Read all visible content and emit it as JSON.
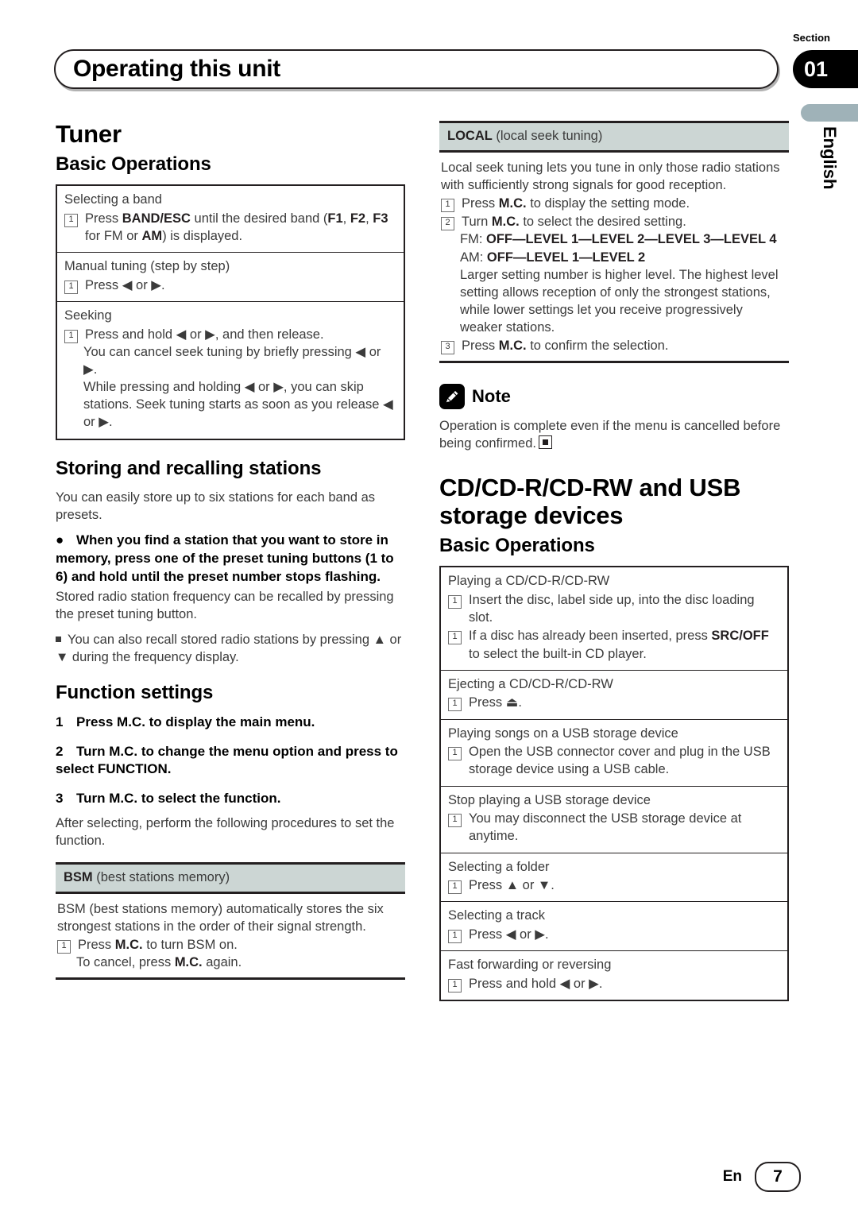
{
  "header": {
    "title": "Operating this unit",
    "section_label": "Section",
    "section_number": "01",
    "language_tab": "English"
  },
  "footer": {
    "language_code": "En",
    "page_number": "7"
  },
  "left_column": {
    "heading": "Tuner",
    "basic_operations_heading": "Basic Operations",
    "basic_operations": [
      {
        "title": "Selecting a band",
        "steps": [
          {
            "num": "1",
            "html": "Press <b>BAND/ESC</b> until the desired band (<b>F1</b>, <b>F2</b>, <b>F3</b> for FM or <b>AM</b>) is displayed."
          }
        ],
        "notes": []
      },
      {
        "title": "Manual tuning (step by step)",
        "steps": [
          {
            "num": "1",
            "html": "Press ◀ or ▶."
          }
        ],
        "notes": []
      },
      {
        "title": "Seeking",
        "steps": [
          {
            "num": "1",
            "html": "Press and hold ◀ or ▶, and then release."
          }
        ],
        "notes": [
          "You can cancel seek tuning by briefly pressing ◀ or ▶.",
          "While pressing and holding ◀ or ▶, you can skip stations. Seek tuning starts as soon as you release ◀ or ▶."
        ]
      }
    ],
    "storing_heading": "Storing and recalling stations",
    "storing_intro": "You can easily store up to six stations for each band as presets.",
    "storing_bold": "When you find a station that you want to store in memory, press one of the preset tuning buttons (1 to 6) and hold until the preset number stops flashing.",
    "storing_after": "Stored radio station frequency can be recalled by pressing the preset tuning button.",
    "storing_note": "You can also recall stored radio stations by pressing ▲ or ▼ during the frequency display.",
    "function_heading": "Function settings",
    "function_steps": [
      {
        "n": "1",
        "text": "Press M.C. to display the main menu."
      },
      {
        "n": "2",
        "text": "Turn M.C. to change the menu option and press to select FUNCTION."
      },
      {
        "n": "3",
        "text": "Turn M.C. to select the function."
      }
    ],
    "function_after": "After selecting, perform the following procedures to set the function.",
    "bsm": {
      "head_bold": "BSM",
      "head_rest": "(best stations memory)",
      "intro": "BSM (best stations memory) automatically stores the six strongest stations in the order of their signal strength.",
      "steps": [
        {
          "num": "1",
          "html": "Press <b>M.C.</b> to turn BSM on."
        }
      ],
      "sub_lines": [
        "To cancel, press <b>M.C.</b> again."
      ]
    }
  },
  "right_column": {
    "local": {
      "head_bold": "LOCAL",
      "head_rest": "(local seek tuning)",
      "intro": "Local seek tuning lets you tune in only those radio stations with sufficiently strong signals for good reception.",
      "steps": [
        {
          "num": "1",
          "html": "Press <b>M.C.</b> to display the setting mode."
        },
        {
          "num": "2",
          "html": "Turn <b>M.C.</b> to select the desired setting."
        }
      ],
      "fm_line": "FM: <b>OFF—LEVEL 1—LEVEL 2—LEVEL 3—LEVEL 4</b>",
      "am_line": "AM: <b>OFF—LEVEL 1—LEVEL 2</b>",
      "explanation": "Larger setting number is higher level. The highest level setting allows reception of only the strongest stations, while lower settings let you receive progressively weaker stations.",
      "final_step": {
        "num": "3",
        "html": "Press <b>M.C.</b> to confirm the selection."
      }
    },
    "note": {
      "label": "Note",
      "text": "Operation is complete even if the menu is cancelled before being confirmed."
    },
    "cd_heading": "CD/CD-R/CD-RW and USB storage devices",
    "cd_basic_operations_heading": "Basic Operations",
    "cd_operations": [
      {
        "title": "Playing a CD/CD-R/CD-RW",
        "steps": [
          {
            "num": "1",
            "html": "Insert the disc, label side up, into the disc loading slot."
          },
          {
            "num": "1",
            "html": "If a disc has already been inserted, press <b>SRC/OFF</b> to select the built-in CD player."
          }
        ]
      },
      {
        "title": "Ejecting a CD/CD-R/CD-RW",
        "steps": [
          {
            "num": "1",
            "html": "Press ⏏."
          }
        ]
      },
      {
        "title": "Playing songs on a USB storage device",
        "steps": [
          {
            "num": "1",
            "html": "Open the USB connector cover and plug in the USB storage device using a USB cable."
          }
        ]
      },
      {
        "title": "Stop playing a USB storage device",
        "steps": [
          {
            "num": "1",
            "html": "You may disconnect the USB storage device at anytime."
          }
        ]
      },
      {
        "title": "Selecting a folder",
        "steps": [
          {
            "num": "1",
            "html": "Press ▲ or ▼."
          }
        ]
      },
      {
        "title": "Selecting a track",
        "steps": [
          {
            "num": "1",
            "html": "Press ◀ or ▶."
          }
        ]
      },
      {
        "title": "Fast forwarding or reversing",
        "steps": [
          {
            "num": "1",
            "html": "Press and hold ◀ or ▶."
          }
        ]
      }
    ]
  },
  "colors": {
    "accent_gray": "#ccd6d4",
    "tab_gray": "#9fb2b8",
    "ink": "#231f20"
  }
}
